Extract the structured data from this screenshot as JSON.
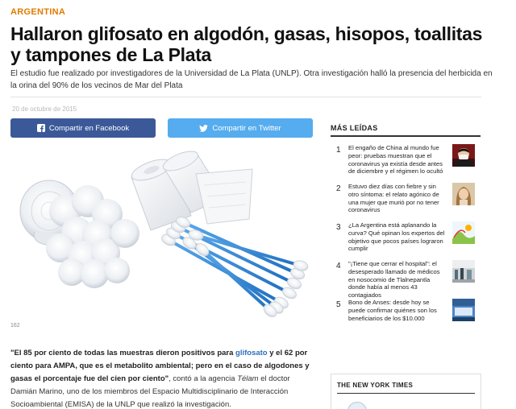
{
  "article": {
    "section": "ARGENTINA",
    "headline": "Hallaron glifosato en algodón, gasas, hisopos, toallitas y tampones de La Plata",
    "lead": "El estudio fue realizado por investigadores de la Universidad de La Plata (UNLP). Otra investigación halló la presencia del herbicida en la orina del 90% de los vecinos de Mar del Plata",
    "date": "20 de octubre de 2015",
    "photo_credit": "162",
    "body": {
      "quote_a": "\"El 85 por ciento de todas las muestras dieron positivos para ",
      "keyword": "glifosato",
      "quote_b": " y el 62 por ciento para AMPA, que es el metabolito ambiental; pero en el caso de algodones y gasas el porcentaje fue del cien por ciento\"",
      "mid": ", contó a la agencia ",
      "source": "Télam",
      "rest": " el doctor Damián Marino, uno de los miembros del Espacio Multidisciplinario de Interacción Socioambiental (EMISA) de la UNLP que realizó la investigación."
    }
  },
  "share": {
    "facebook_label": "Compartir en Facebook",
    "twitter_label": "Compartir en Twitter",
    "facebook_color": "#3b5998",
    "twitter_color": "#55acee"
  },
  "sidebar": {
    "most_read_title": "MÁS LEÍDAS",
    "items": [
      {
        "rank": "1",
        "text": "El engaño de China al mundo fue peor: pruebas muestran que el coronavirus ya existía desde antes de diciembre y el régimen lo ocultó",
        "thumb": "masked-person"
      },
      {
        "rank": "2",
        "text": "Estuvo diez días con fiebre y sin otro síntoma: el relato agónico de una mujer que murió por no tener coronavirus",
        "thumb": "woman-portrait"
      },
      {
        "rank": "3",
        "text": "¿La Argentina está aplanando la curva? Qué opinan los expertos del objetivo que pocos países lograron cumplir",
        "thumb": "illustration-chart"
      },
      {
        "rank": "4",
        "text": "\"¡Tiene que cerrar el hospital\": el desesperado llamado de médicos en nosocomio de Tlalnepantla donde había al menos 43 contagiados",
        "thumb": "hospital-corridor"
      },
      {
        "rank": "5",
        "text": "Bono de Anses: desde hoy se puede confirmar quiénes son los beneficiarios de los $10.000",
        "thumb": "anses-sign"
      }
    ],
    "nyt_title": "THE NEW YORK TIMES"
  }
}
